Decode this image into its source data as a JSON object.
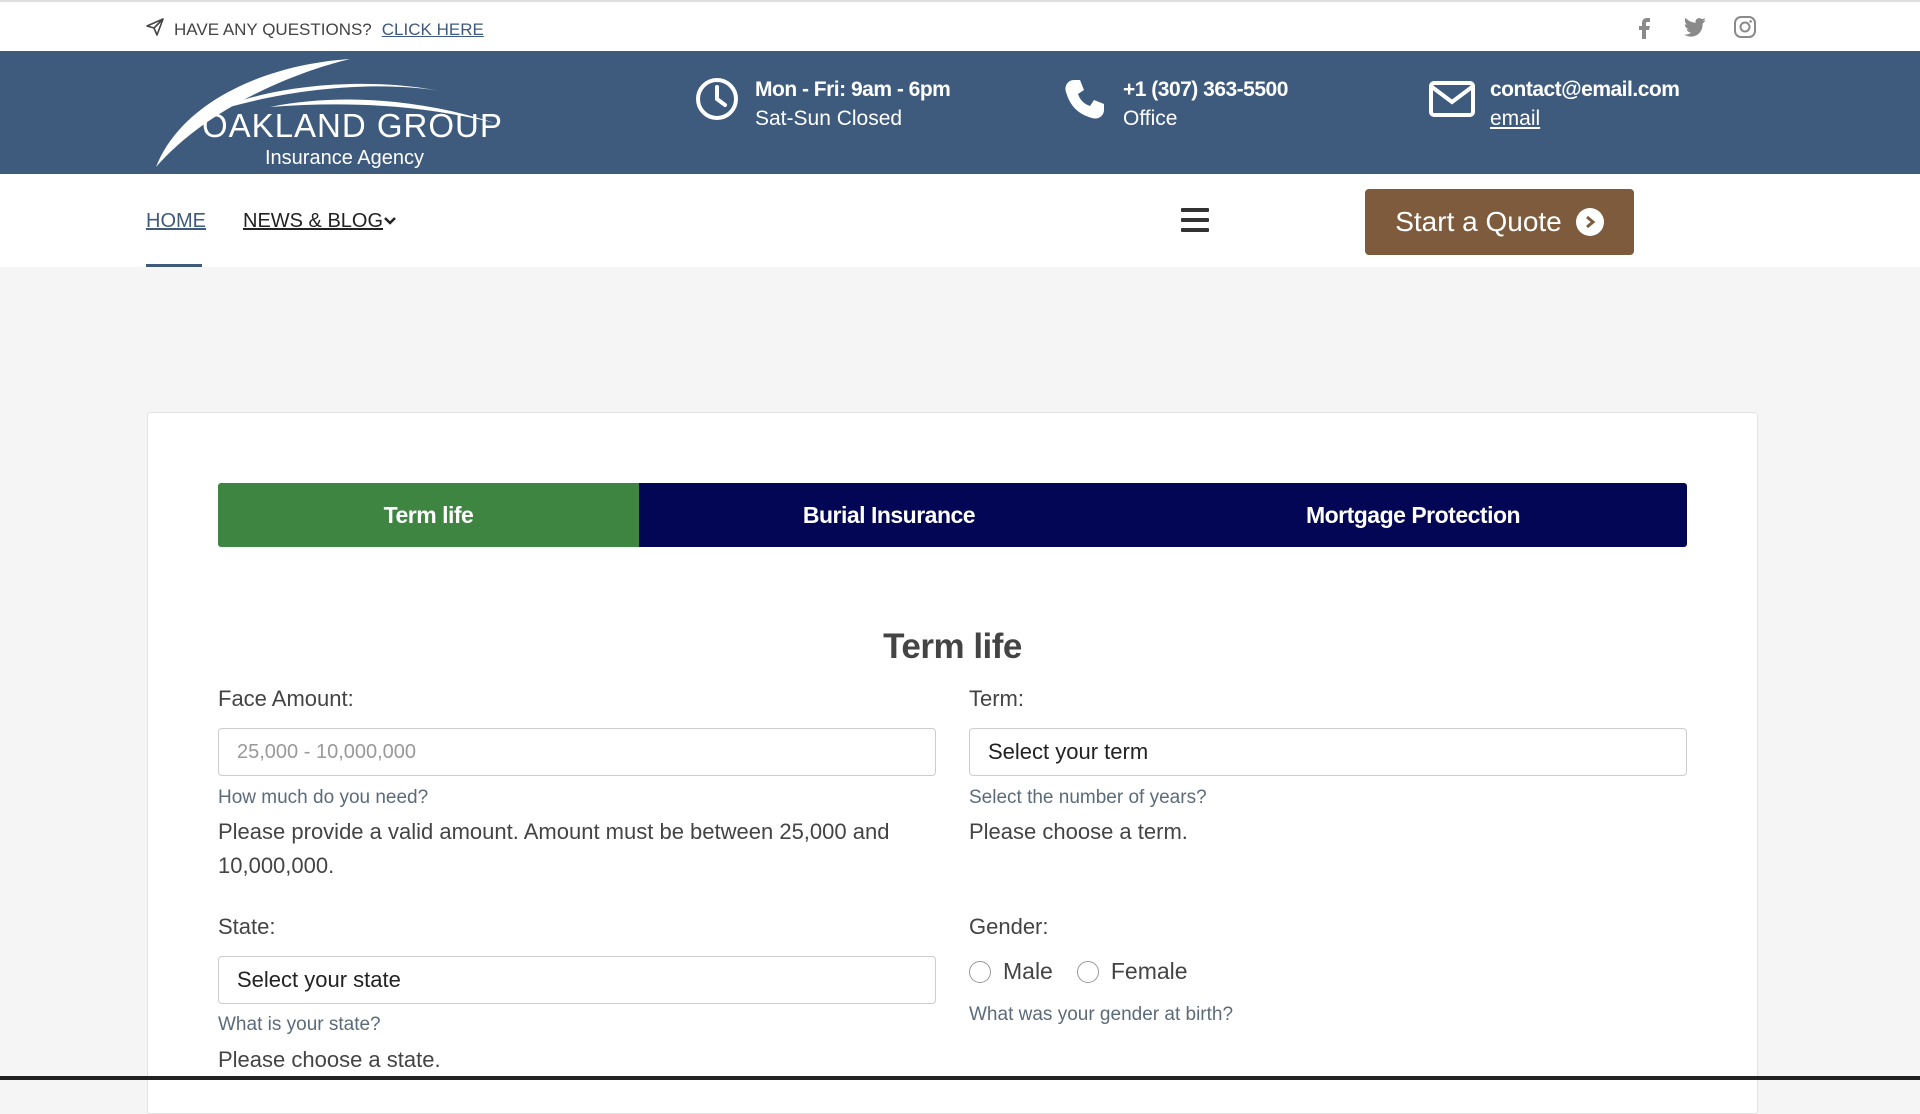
{
  "topbar": {
    "question": "HAVE ANY QUESTIONS?",
    "cta": "CLICK HERE",
    "social": [
      "facebook-icon",
      "twitter-icon",
      "instagram-icon"
    ]
  },
  "header": {
    "logo_name": "OAKLAND GROUP",
    "logo_sub": "Insurance Agency",
    "hours": {
      "line1": "Mon - Fri: 9am - 6pm",
      "line2": "Sat-Sun Closed"
    },
    "phone": {
      "line1": "+1 (307) 363-5500",
      "line2": "Office"
    },
    "email": {
      "line1": "contact@email.com",
      "line2": "email"
    }
  },
  "nav": {
    "home": "HOME",
    "blog": "NEWS & BLOG",
    "quote_button": "Start a Quote"
  },
  "tabs": [
    {
      "label": "Term life",
      "active": true
    },
    {
      "label": "Burial Insurance",
      "active": false
    },
    {
      "label": "Mortgage Protection",
      "active": false
    }
  ],
  "form": {
    "title": "Term life",
    "face_amount": {
      "label": "Face Amount:",
      "placeholder": "25,000 - 10,000,000",
      "help": "How much do you need?",
      "error": "Please provide a valid amount. Amount must be between 25,000 and 10,000,000."
    },
    "term": {
      "label": "Term:",
      "value": "Select your term",
      "help": "Select the number of years?",
      "error": "Please choose a term."
    },
    "state": {
      "label": "State:",
      "value": "Select your state",
      "help": "What is your state?",
      "error": "Please choose a state."
    },
    "gender": {
      "label": "Gender:",
      "options": [
        "Male",
        "Female"
      ],
      "help": "What was your gender at birth?"
    }
  },
  "colors": {
    "header_bg": "#3e5b7e",
    "active_tab": "#3f8542",
    "inactive_tab": "#020654",
    "quote_button": "#7d5b3c"
  }
}
